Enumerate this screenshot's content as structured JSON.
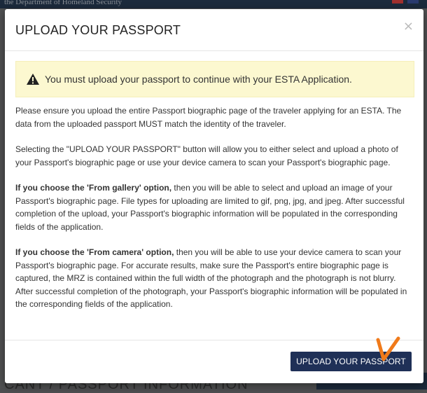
{
  "background": {
    "top_bar_text": "the Department of Homeland Security",
    "section_heading": "CANT / PASSPORT INFORMATION"
  },
  "modal": {
    "title": "UPLOAD YOUR PASSPORT",
    "close_symbol": "×",
    "alert_text": "You must upload your passport to continue with your ESTA Application.",
    "paragraph_1": "Please ensure you upload the entire Passport biographic page of the traveler applying for an ESTA.  The data from the uploaded passport MUST match the identity of the traveler.",
    "paragraph_2": "Selecting the \"UPLOAD YOUR PASSPORT\" button will allow you to either select and upload a photo of your Passport's biographic page or use your device camera to scan your Passport's biographic page.",
    "gallery_lead": "If you choose the 'From gallery' option,",
    "gallery_text": " then you will be able to select and upload an image of your Passport's biographic page. File types for uploading are limited to gif, png, jpg, and jpeg. After successful completion of the upload, your Passport's biographic information will be populated in the corresponding fields of the application.",
    "camera_lead": "If you choose the 'From camera' option,",
    "camera_text": " then you will be able to use your device camera to scan your Passport's biographic page. For accurate results, make sure the Passport's entire biographic page is captured, the MRZ is contained within the full width of the photograph and the photograph is not blurry. After successful completion of the photograph, your Passport's biographic information will be populated in the corresponding fields of the application.",
    "upload_button_label": "UPLOAD YOUR PASSPORT"
  },
  "colors": {
    "primary_button": "#1f3057",
    "alert_background": "#fcf8d0",
    "annotation_check": "#f07a1a"
  },
  "icons": {
    "alert": "warning-triangle-icon",
    "close": "close-icon"
  }
}
